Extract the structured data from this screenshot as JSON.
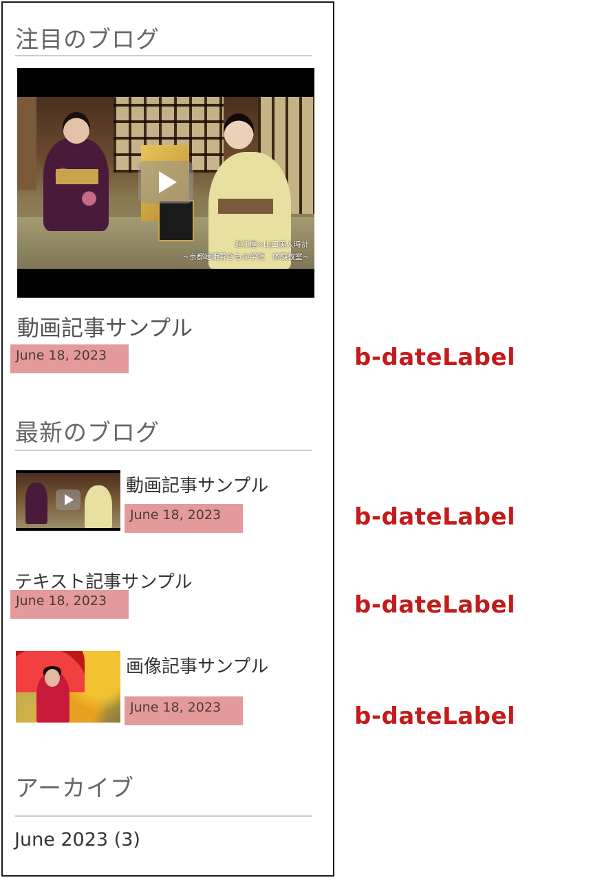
{
  "sections": {
    "featured": {
      "heading": "注目のブログ",
      "video": {
        "caption_line1": "近江屋×山口美人時計",
        "caption_line2": "~京都嵯峨野きもの学院　体験教室~"
      },
      "post_title": "動画記事サンプル",
      "date": "June 18, 2023"
    },
    "latest": {
      "heading": "最新のブログ",
      "posts": [
        {
          "title": "動画記事サンプル",
          "date": "June 18, 2023",
          "thumbnail": "video-thumbnail"
        },
        {
          "title": "テキスト記事サンプル",
          "date": "June 18, 2023",
          "thumbnail": ""
        },
        {
          "title": "画像記事サンプル",
          "date": "June 18, 2023",
          "thumbnail": "image-thumbnail"
        }
      ]
    },
    "archive": {
      "heading": "アーカイブ",
      "items": [
        {
          "label": "June 2023 (3)"
        }
      ]
    }
  },
  "annotations": {
    "date_label_name": "b-dateLabel"
  },
  "colors": {
    "date_label_bg": "#e49a9a",
    "annotation_text": "#c41a1a",
    "heading_text": "#666666",
    "rule": "#cfcdc4"
  }
}
